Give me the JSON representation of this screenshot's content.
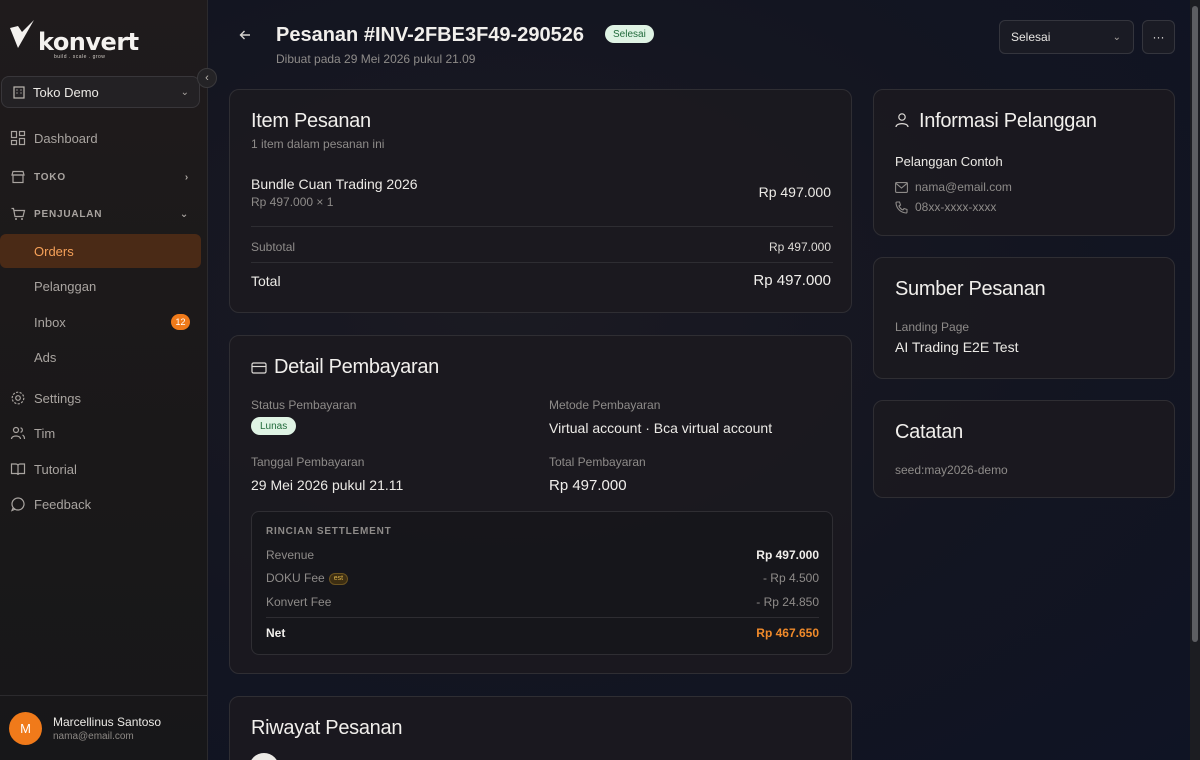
{
  "brand": {
    "logo_text": "konvert",
    "tagline": "build . scale . grow"
  },
  "store": {
    "name": "Toko Demo"
  },
  "nav": {
    "dashboard": "Dashboard",
    "toko": "TOKO",
    "penjualan": "PENJUALAN",
    "orders": "Orders",
    "pelanggan": "Pelanggan",
    "inbox": "Inbox",
    "inbox_count": "12",
    "ads": "Ads",
    "settings": "Settings",
    "tim": "Tim",
    "tutorial": "Tutorial",
    "feedback": "Feedback"
  },
  "user": {
    "initial": "M",
    "name": "Marcellinus Santoso",
    "email": "nama@email.com"
  },
  "header": {
    "title": "Pesanan #INV-2FBE3F49-290526",
    "status_badge": "Selesai",
    "subtitle": "Dibuat pada 29 Mei 2026 pukul 21.09",
    "status_select": "Selesai",
    "more": "···"
  },
  "items_card": {
    "title": "Item Pesanan",
    "subtitle": "1 item dalam pesanan ini",
    "items": [
      {
        "name": "Bundle Cuan Trading 2026",
        "detail": "Rp 497.000 × 1",
        "price": "Rp 497.000"
      }
    ],
    "subtotal_label": "Subtotal",
    "subtotal_value": "Rp 497.000",
    "total_label": "Total",
    "total_value": "Rp 497.000"
  },
  "payment_card": {
    "title": "Detail Pembayaran",
    "status_label": "Status Pembayaran",
    "status_value": "Lunas",
    "method_label": "Metode Pembayaran",
    "method_value": "Virtual account · Bca virtual account",
    "date_label": "Tanggal Pembayaran",
    "date_value": "29 Mei 2026 pukul 21.11",
    "total_label": "Total Pembayaran",
    "total_value": "Rp 497.000",
    "settlement": {
      "title": "RINCIAN SETTLEMENT",
      "revenue_label": "Revenue",
      "revenue_value": "Rp 497.000",
      "doku_label": "DOKU Fee",
      "doku_badge": "est",
      "doku_value": "- Rp 4.500",
      "konvert_label": "Konvert Fee",
      "konvert_value": "- Rp 24.850",
      "net_label": "Net",
      "net_value": "Rp 467.650"
    }
  },
  "history_card": {
    "title": "Riwayat Pesanan"
  },
  "customer_card": {
    "title": "Informasi Pelanggan",
    "name": "Pelanggan Contoh",
    "email": "nama@email.com",
    "phone": "08xx-xxxx-xxxx"
  },
  "source_card": {
    "title": "Sumber Pesanan",
    "label": "Landing Page",
    "value": "AI Trading E2E Test"
  },
  "notes_card": {
    "title": "Catatan",
    "value": "seed:may2026-demo"
  },
  "colors": {
    "accent": "#f07a1a",
    "success_bg": "#dff3e4",
    "success_text": "#226b3c",
    "net": "#f08a2a"
  }
}
